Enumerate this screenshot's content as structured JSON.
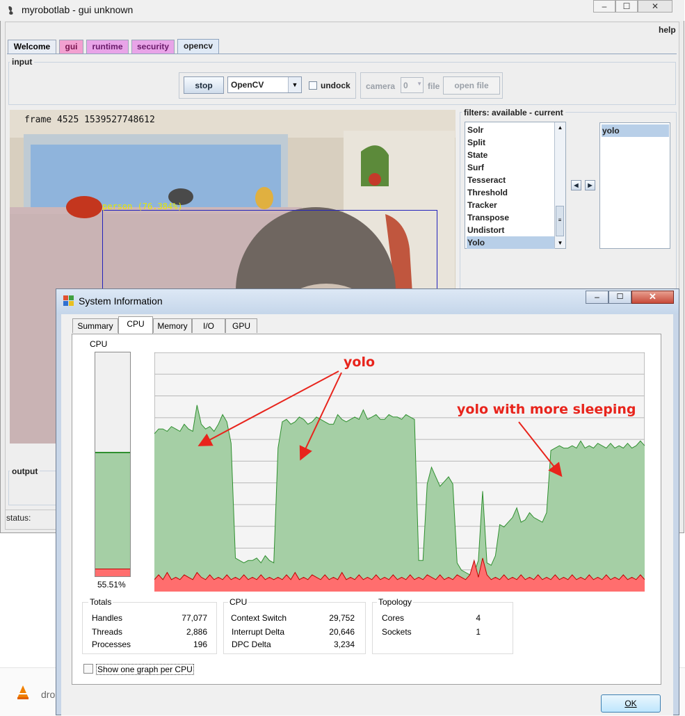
{
  "colors": {
    "accent": "#b8cfe8",
    "cpu_green": "#a5cfa5",
    "cpu_green_line": "#2f8f2f",
    "cpu_red": "#ff6e6e",
    "cpu_red_line": "#c00000",
    "annotation": "#e8241c",
    "overlay_yellow": "#e8e800",
    "bbox_blue": "#2222bb"
  },
  "java": {
    "title": "myrobotlab - gui unknown",
    "menu_help": "help",
    "tabs": [
      "Welcome",
      "gui",
      "runtime",
      "security",
      "opencv"
    ],
    "input_label": "input",
    "stop": "stop",
    "engine": "OpenCV",
    "undock": "undock",
    "camera": "camera",
    "camera_index": "0",
    "file": "file",
    "open_file": "open file",
    "filters_label": "filters: available - current",
    "filters_available": [
      "Solr",
      "Split",
      "State",
      "Surf",
      "Tesseract",
      "Threshold",
      "Tracker",
      "Transpose",
      "Undistort",
      "Yolo"
    ],
    "filters_selected": "Yolo",
    "filters_current": [
      "yolo"
    ],
    "frame_text": "frame 4525 1539527748612",
    "detection": "person (76.384%)",
    "output_label": "output",
    "status_label": "status:"
  },
  "sysinfo": {
    "title": "System Information",
    "tabs": [
      "Summary",
      "CPU",
      "Memory",
      "I/O",
      "GPU"
    ],
    "active_tab": "CPU",
    "cpu_label": "CPU",
    "cpu_percent": "55.51%",
    "cpu_usage_fraction": 0.5551,
    "cpu_kernel_fraction": 0.035,
    "annotations": [
      "yolo",
      "yolo with more sleeping"
    ],
    "totals": {
      "title": "Totals",
      "rows": [
        [
          "Handles",
          "77,077"
        ],
        [
          "Threads",
          "2,886"
        ],
        [
          "Processes",
          "196"
        ]
      ]
    },
    "cpu": {
      "title": "CPU",
      "rows": [
        [
          "Context Switch",
          "29,752"
        ],
        [
          "Interrupt Delta",
          "20,646"
        ],
        [
          "DPC Delta",
          "3,234"
        ]
      ]
    },
    "topology": {
      "title": "Topology",
      "rows": [
        [
          "Cores",
          "4"
        ],
        [
          "Sockets",
          "1"
        ]
      ]
    },
    "checkbox": "Show one graph per CPU",
    "ok": "OK"
  },
  "desktop": {
    "taskbar_snippet": "dro"
  },
  "chart_data": {
    "type": "area",
    "title": "",
    "series": [
      {
        "values": [
          0.66,
          0.68,
          0.68,
          0.67,
          0.69,
          0.68,
          0.67,
          0.7,
          0.68,
          0.67,
          0.78,
          0.7,
          0.68,
          0.69,
          0.67,
          0.7,
          0.74,
          0.71,
          0.62,
          0.14,
          0.13,
          0.12,
          0.13,
          0.13,
          0.14,
          0.12,
          0.15,
          0.13,
          0.12,
          0.6,
          0.71,
          0.72,
          0.7,
          0.71,
          0.73,
          0.72,
          0.7,
          0.71,
          0.73,
          0.72,
          0.71,
          0.7,
          0.7,
          0.74,
          0.72,
          0.71,
          0.72,
          0.73,
          0.72,
          0.76,
          0.72,
          0.73,
          0.74,
          0.72,
          0.72,
          0.74,
          0.73,
          0.73,
          0.72,
          0.74,
          0.73,
          0.72,
          0.13,
          0.13,
          0.45,
          0.52,
          0.48,
          0.44,
          0.46,
          0.48,
          0.45,
          0.12,
          0.09,
          0.08,
          0.07,
          0.08,
          0.13,
          0.42,
          0.12,
          0.11,
          0.15,
          0.28,
          0.27,
          0.29,
          0.31,
          0.35,
          0.29,
          0.3,
          0.33,
          0.31,
          0.3,
          0.29,
          0.33,
          0.59,
          0.6,
          0.61,
          0.6,
          0.6,
          0.61,
          0.6,
          0.63,
          0.6,
          0.61,
          0.6,
          0.62,
          0.61,
          0.6,
          0.62,
          0.6,
          0.61,
          0.6,
          0.62,
          0.6,
          0.61,
          0.63,
          0.61
        ]
      },
      {
        "values": [
          0.05,
          0.07,
          0.05,
          0.08,
          0.05,
          0.06,
          0.05,
          0.07,
          0.06,
          0.05,
          0.08,
          0.06,
          0.05,
          0.07,
          0.05,
          0.06,
          0.05,
          0.07,
          0.05,
          0.06,
          0.05,
          0.07,
          0.05,
          0.06,
          0.05,
          0.07,
          0.05,
          0.06,
          0.05,
          0.06,
          0.05,
          0.07,
          0.05,
          0.08,
          0.05,
          0.06,
          0.05,
          0.07,
          0.06,
          0.05,
          0.07,
          0.05,
          0.06,
          0.05,
          0.08,
          0.05,
          0.06,
          0.05,
          0.07,
          0.05,
          0.06,
          0.05,
          0.07,
          0.05,
          0.06,
          0.05,
          0.07,
          0.05,
          0.06,
          0.05,
          0.07,
          0.05,
          0.06,
          0.05,
          0.07,
          0.06,
          0.05,
          0.07,
          0.05,
          0.06,
          0.05,
          0.07,
          0.06,
          0.05,
          0.07,
          0.13,
          0.06,
          0.14,
          0.07,
          0.05,
          0.06,
          0.05,
          0.07,
          0.05,
          0.06,
          0.05,
          0.07,
          0.05,
          0.06,
          0.05,
          0.07,
          0.05,
          0.06,
          0.05,
          0.07,
          0.05,
          0.06,
          0.05,
          0.07,
          0.05,
          0.06,
          0.05,
          0.07,
          0.05,
          0.06,
          0.05,
          0.07,
          0.05,
          0.06,
          0.05,
          0.07,
          0.05,
          0.06,
          0.05,
          0.07,
          0.05
        ]
      }
    ],
    "ylim": [
      0,
      1
    ],
    "grid": true
  }
}
